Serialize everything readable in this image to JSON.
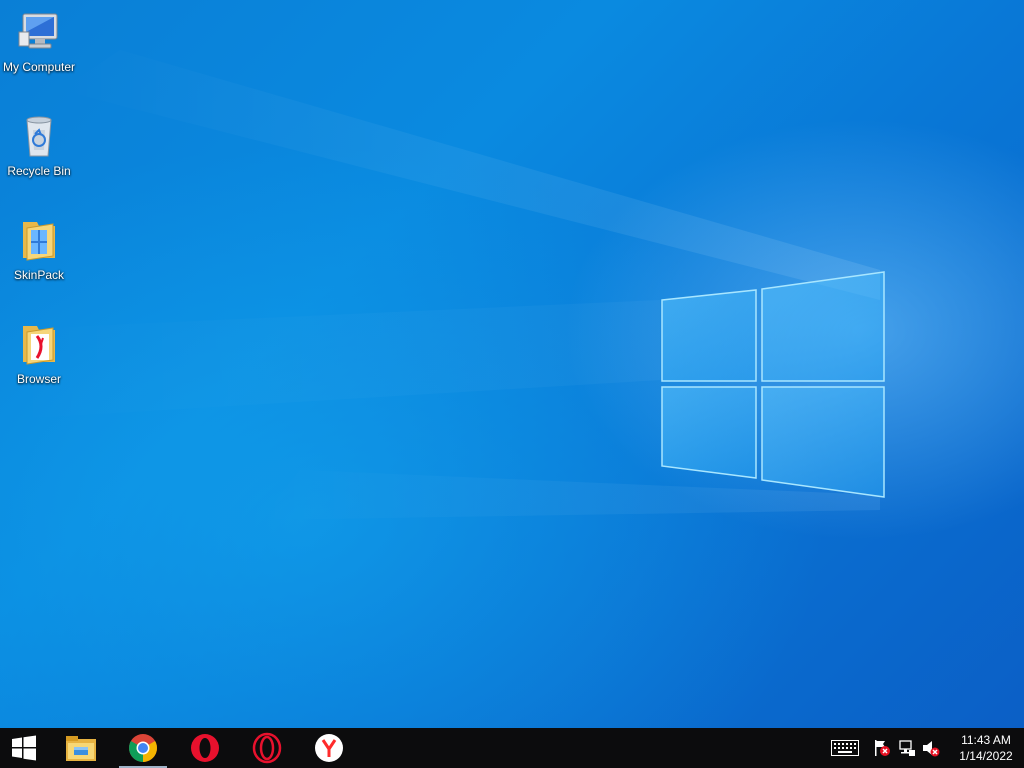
{
  "desktop": {
    "icons": [
      {
        "label": "My Computer",
        "icon": "computer-icon"
      },
      {
        "label": "Recycle Bin",
        "icon": "recycle-bin-icon"
      },
      {
        "label": "SkinPack",
        "icon": "folder-icon"
      },
      {
        "label": "Browser",
        "icon": "folder-icon"
      }
    ]
  },
  "taskbar": {
    "start": "start-icon",
    "pinned": [
      {
        "name": "File Explorer",
        "icon": "file-explorer-icon"
      },
      {
        "name": "Google Chrome",
        "icon": "chrome-icon",
        "active": true
      },
      {
        "name": "Opera",
        "icon": "opera-icon"
      },
      {
        "name": "Opera GX",
        "icon": "opera-gx-icon"
      },
      {
        "name": "Yandex Browser",
        "icon": "yandex-icon"
      }
    ],
    "tray": [
      "keyboard-icon",
      "action-center-flag-icon",
      "network-icon",
      "volume-muted-icon"
    ],
    "clock": {
      "time": "11:43 AM",
      "date": "1/14/2022"
    }
  },
  "colors": {
    "wallpaper_blue": "#0a7fd6",
    "taskbar": "#0c0c0d",
    "chrome_red": "#db4437",
    "chrome_green": "#0f9d58",
    "chrome_yellow": "#f4b400",
    "opera_red": "#e8112d",
    "yandex_red": "#ff2b2b"
  }
}
